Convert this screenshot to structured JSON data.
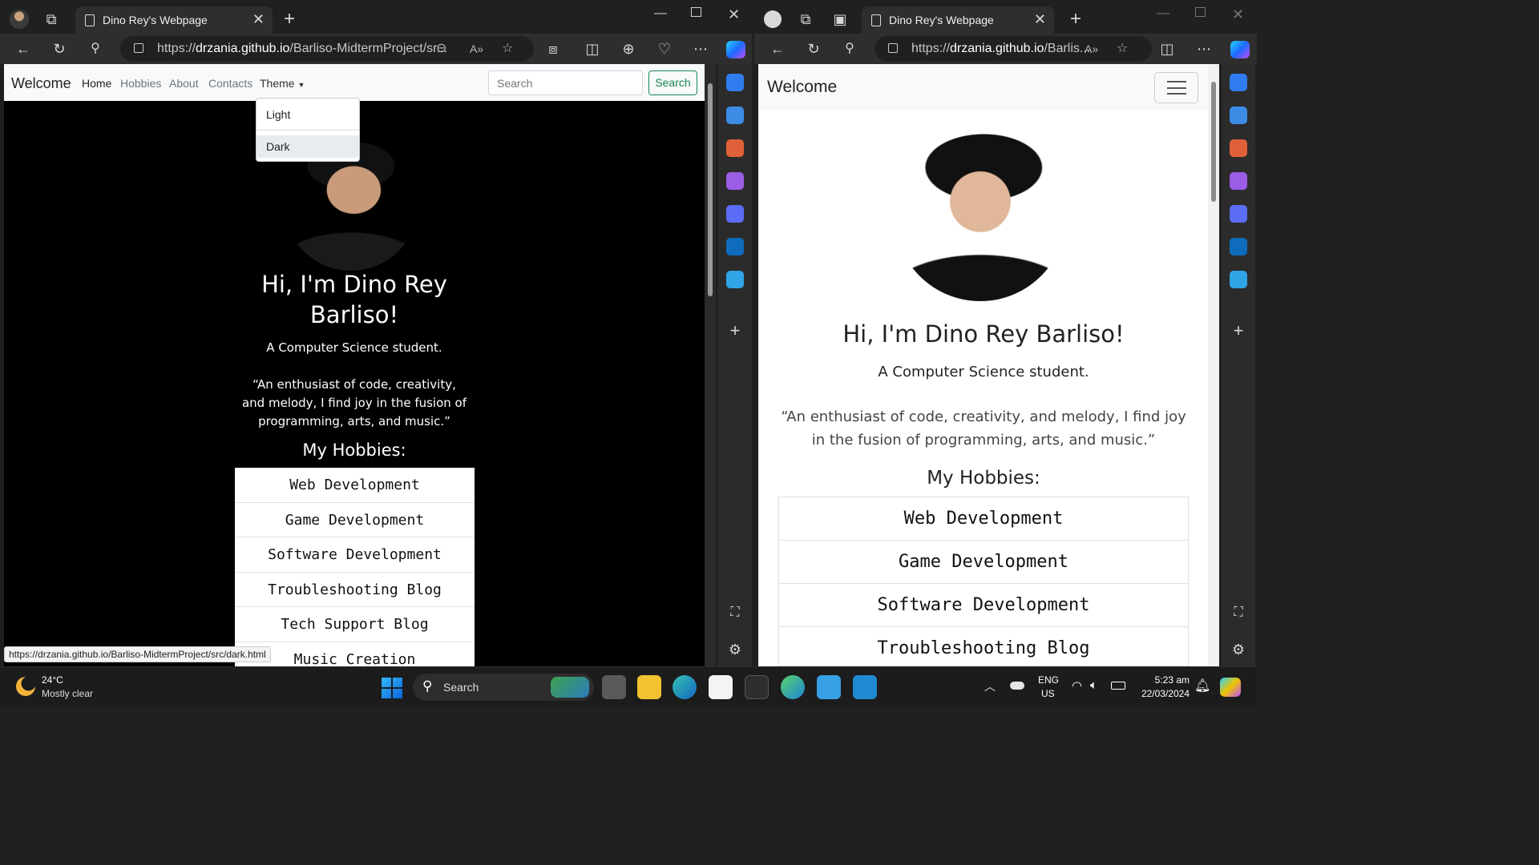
{
  "left_window": {
    "tab_title": "Dino Rey's Webpage",
    "url_prefix": "https://",
    "url_domain": "drzania.github.io",
    "url_path": "/Barliso-MidtermProject/sr...",
    "navbar": {
      "brand": "Welcome",
      "links": [
        "Home",
        "Hobbies",
        "About",
        "Contacts",
        "Theme"
      ],
      "search_placeholder": "Search",
      "search_button": "Search"
    },
    "theme_menu": {
      "items": [
        "Light",
        "Dark"
      ]
    },
    "hero": {
      "heading": "Hi, I'm Dino Rey Barliso!",
      "subtitle": "A Computer Science student.",
      "quote": "“An enthusiast of code, creativity, and melody, I find joy in the fusion of programming, arts, and music.”",
      "hobbies_title": "My Hobbies:"
    },
    "hobbies": [
      "Web Development",
      "Game Development",
      "Software Development",
      "Troubleshooting Blog",
      "Tech Support Blog",
      "Music Creation"
    ],
    "status_url": "https://drzania.github.io/Barliso-MidtermProject/src/dark.html"
  },
  "right_window": {
    "tab_title": "Dino Rey's Webpage",
    "url_prefix": "https://",
    "url_domain": "drzania.github.io",
    "url_path": "/Barlis...",
    "navbar": {
      "brand": "Welcome"
    },
    "hero": {
      "heading": "Hi, I'm Dino Rey Barliso!",
      "subtitle": "A Computer Science student.",
      "quote": "“An enthusiast of code, creativity, and melody, I find joy in the fusion of programming, arts, and music.”",
      "hobbies_title": "My Hobbies:"
    },
    "hobbies": [
      "Web Development",
      "Game Development",
      "Software Development",
      "Troubleshooting Blog"
    ]
  },
  "taskbar": {
    "weather_temp": "24°C",
    "weather_desc": "Mostly clear",
    "search_label": "Search",
    "lang_top": "ENG",
    "lang_bottom": "US",
    "time": "5:23 am",
    "date": "22/03/2024"
  },
  "colors": {
    "accent_green": "#198754",
    "dark_bg": "#000000",
    "light_bg": "#ffffff"
  }
}
